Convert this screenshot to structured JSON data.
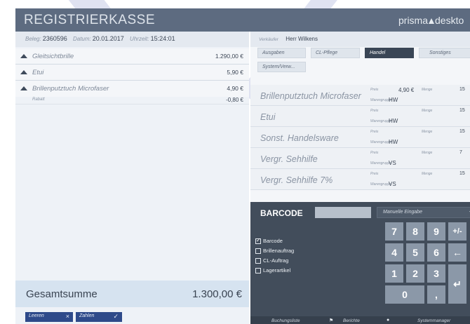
{
  "app": {
    "title": "REGISTRIERKASSE",
    "brand_left": "prisma",
    "brand_right": "deskto"
  },
  "meta": {
    "beleg_label": "Beleg:",
    "beleg_value": "2360596",
    "datum_label": "Datum:",
    "datum_value": "20.01.2017",
    "uhrzeit_label": "Uhrzeit:",
    "uhrzeit_value": "15:24:01"
  },
  "items": [
    {
      "name": "Gleitsichtbrille",
      "price": "1.290,00 €"
    },
    {
      "name": "Etui",
      "price": "5,90 €"
    },
    {
      "name": "Brillenputztuch Microfaser",
      "price": "4,90 €",
      "sub_name": "Rabatt",
      "sub_price": "-0,80 €"
    }
  ],
  "total": {
    "label": "Gesamtsumme",
    "amount": "1.300,00 €"
  },
  "actions": {
    "clear_label": "Leeren",
    "clear_icon": "×",
    "pay_label": "Zahlen",
    "pay_icon": "✓"
  },
  "seller": {
    "label": "Verkäufer",
    "value": "Herr Wilkens"
  },
  "tabs": [
    {
      "label": "Ausgaben",
      "active": false
    },
    {
      "label": "CL-Pflege",
      "active": false
    },
    {
      "label": "Handel",
      "active": true
    },
    {
      "label": "Sonstiges",
      "active": false
    },
    {
      "label": "System/Verw...",
      "active": false
    }
  ],
  "products": [
    {
      "name": "Brillenputztuch Microfaser",
      "preis_label": "Preis",
      "preis": "4,90 €",
      "menge_label": "Menge",
      "menge": "15",
      "wg_label": "Warengruppe",
      "wg": "HW"
    },
    {
      "name": "Etui",
      "preis_label": "Preis",
      "preis": "",
      "menge_label": "Menge",
      "menge": "15",
      "wg_label": "Warengruppe",
      "wg": "HW"
    },
    {
      "name": "Sonst. Handelsware",
      "preis_label": "Preis",
      "preis": "",
      "menge_label": "Menge",
      "menge": "15",
      "wg_label": "Warengruppe",
      "wg": "HW"
    },
    {
      "name": "Vergr. Sehhilfe",
      "preis_label": "Preis",
      "preis": "",
      "menge_label": "Menge",
      "menge": "7",
      "wg_label": "Warengruppe",
      "wg": "VS"
    },
    {
      "name": "Vergr. Sehhilfe 7%",
      "preis_label": "Preis",
      "preis": "",
      "menge_label": "Menge",
      "menge": "15",
      "wg_label": "Warengruppe",
      "wg": "VS"
    }
  ],
  "barcode": {
    "label": "BARCODE",
    "input_value": "",
    "mode_selected": "Manuelle Eingabe"
  },
  "checkboxes": [
    {
      "label": "Barcode",
      "checked": true
    },
    {
      "label": "Brillenauftrag",
      "checked": false
    },
    {
      "label": "CL-Auftrag",
      "checked": false
    },
    {
      "label": "Lagerartikel",
      "checked": false
    }
  ],
  "keypad": {
    "k7": "7",
    "k8": "8",
    "k9": "9",
    "plusminus": "+/-",
    "k4": "4",
    "k5": "5",
    "k6": "6",
    "back": "←",
    "k1": "1",
    "k2": "2",
    "k3": "3",
    "enter": "↵",
    "k0": "0",
    "comma": ","
  },
  "footer": {
    "buchungsliste": "Buchungsliste",
    "berichte": "Berichte",
    "systemmanager": "Systemmanager"
  },
  "colors": {
    "titlebar": "#5d6b80",
    "accent_button": "#2e4a8a",
    "keypad_key": "#8b98a8",
    "panel_dark": "#424d5b"
  }
}
